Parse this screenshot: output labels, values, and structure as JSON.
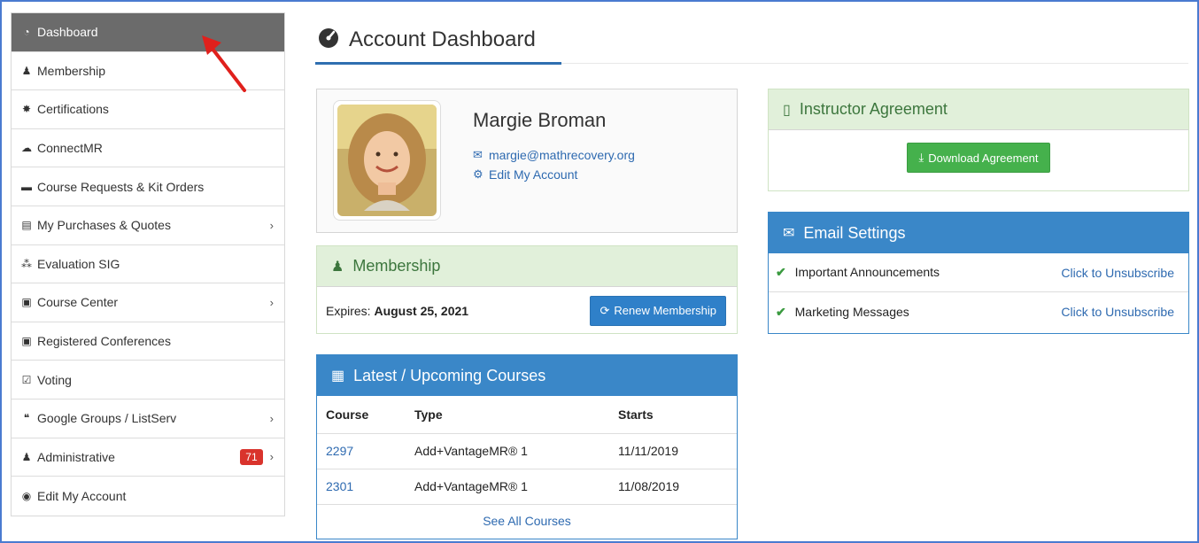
{
  "sidebar": {
    "items": [
      {
        "label": "Dashboard",
        "icon": "dashboard-icon",
        "glyph": "◔",
        "chevron": false,
        "active": true
      },
      {
        "label": "Membership",
        "icon": "user-icon",
        "glyph": "👤",
        "chevron": false
      },
      {
        "label": "Certifications",
        "icon": "certificate-icon",
        "glyph": "✸",
        "chevron": false
      },
      {
        "label": "ConnectMR",
        "icon": "cloud-icon",
        "glyph": "☁",
        "chevron": false
      },
      {
        "label": "Course Requests & Kit Orders",
        "icon": "toolbox-icon",
        "glyph": "⛟",
        "chevron": false
      },
      {
        "label": "My Purchases & Quotes",
        "icon": "boxes-icon",
        "glyph": "▤",
        "chevron": true
      },
      {
        "label": "Evaluation SIG",
        "icon": "users-icon",
        "glyph": "⁂",
        "chevron": false
      },
      {
        "label": "Course Center",
        "icon": "teacher-icon",
        "glyph": "▣",
        "chevron": true
      },
      {
        "label": "Registered Conferences",
        "icon": "teacher-icon",
        "glyph": "▣",
        "chevron": false
      },
      {
        "label": "Voting",
        "icon": "vote-icon",
        "glyph": "☑",
        "chevron": false
      },
      {
        "label": "Google Groups / ListServ",
        "icon": "comments-icon",
        "glyph": "💬",
        "chevron": true
      },
      {
        "label": "Administrative",
        "icon": "user-cog-icon",
        "glyph": "👤",
        "chevron": true,
        "badge": "71"
      },
      {
        "label": "Edit My Account",
        "icon": "user-circle-icon",
        "glyph": "◉",
        "chevron": false
      }
    ]
  },
  "main": {
    "title": "Account Dashboard"
  },
  "profile": {
    "name": "Margie Broman",
    "email": "margie@mathrecovery.org",
    "edit_label": "Edit My Account"
  },
  "membership": {
    "title": "Membership",
    "expires_label": "Expires:",
    "expires_date": "August 25, 2021",
    "renew_label": "Renew Membership"
  },
  "courses": {
    "title": "Latest / Upcoming Courses",
    "columns": [
      "Course",
      "Type",
      "Starts"
    ],
    "rows": [
      {
        "course": "2297",
        "type": "Add+VantageMR® 1",
        "starts": "11/11/2019"
      },
      {
        "course": "2301",
        "type": "Add+VantageMR® 1",
        "starts": "11/08/2019"
      }
    ],
    "see_all": "See All Courses"
  },
  "instructor": {
    "title": "Instructor Agreement",
    "download_label": "Download Agreement"
  },
  "email": {
    "title": "Email Settings",
    "rows": [
      {
        "label": "Important Announcements",
        "action": "Click to Unsubscribe"
      },
      {
        "label": "Marketing Messages",
        "action": "Click to Unsubscribe"
      }
    ]
  },
  "colors": {
    "accent_blue": "#3a87c8",
    "success_green": "#45b14c",
    "badge_red": "#d9332c",
    "active_sidebar": "#6b6b6b"
  }
}
